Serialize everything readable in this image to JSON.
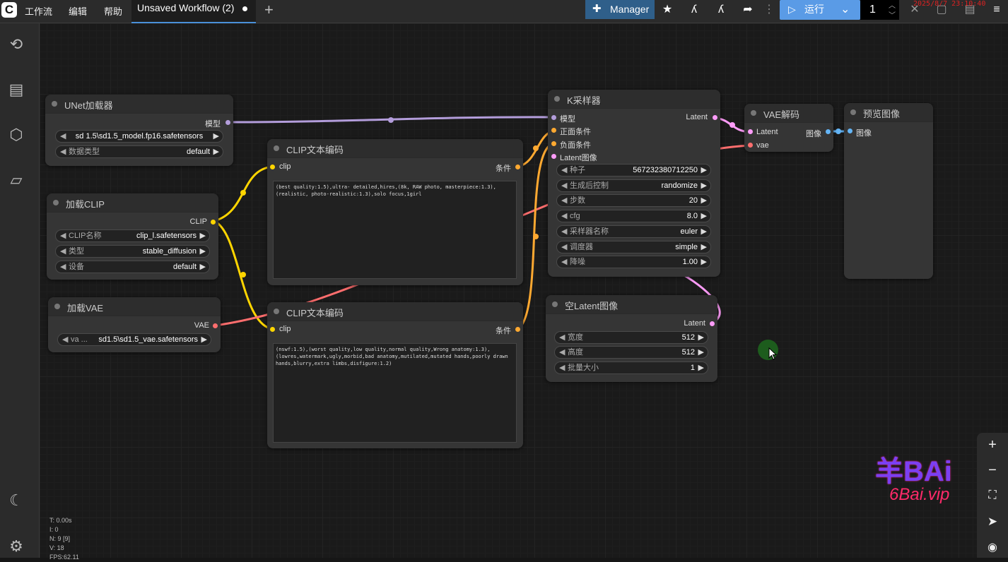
{
  "topbar": {
    "menu": [
      "工作流",
      "编辑",
      "帮助"
    ],
    "tab_title": "Unsaved Workflow (2)",
    "manager_label": "Manager",
    "run_label": "运行",
    "queue_count": "1",
    "clock_text": "2025/8/7 23:10:40"
  },
  "nodes": {
    "unet": {
      "title": "UNet加载器",
      "out": "模型",
      "w1_value": "sd 1.5\\sd1.5_model.fp16.safetensors",
      "w2_label": "数据类型",
      "w2_value": "default"
    },
    "clip_loader": {
      "title": "加载CLIP",
      "out": "CLIP",
      "w1_label": "CLIP名称",
      "w1_value": "clip_l.safetensors",
      "w2_label": "类型",
      "w2_value": "stable_diffusion",
      "w3_label": "设备",
      "w3_value": "default"
    },
    "vae_loader": {
      "title": "加载VAE",
      "out": "VAE",
      "w1_label": "va ...",
      "w1_value": "sd1.5\\sd1.5_vae.safetensors"
    },
    "clip_pos": {
      "title": "CLIP文本编码",
      "in": "clip",
      "out": "条件",
      "text": "(best quality:1.5),ultra- detailed,hires,(8k, RAW photo, masterpiece:1.3),(realistic, photo-realistic:1.3),solo focus,1girl"
    },
    "clip_neg": {
      "title": "CLIP文本编码",
      "in": "clip",
      "out": "条件",
      "text": "(nswf:1.5),(worst quality,low quality,normal quality,Wrong anatomy:1.3),(lowres,watermark,ugly,morbid,bad anatomy,mutilated,mutated hands,poorly drawn hands,blurry,extra limbs,disfigure:1.2)"
    },
    "ksampler": {
      "title": "K采样器",
      "in1": "模型",
      "in2": "正面条件",
      "in3": "负面条件",
      "in4": "Latent图像",
      "out": "Latent",
      "widgets": [
        {
          "label": "种子",
          "value": "567232380712250"
        },
        {
          "label": "生成后控制",
          "value": "randomize"
        },
        {
          "label": "步数",
          "value": "20"
        },
        {
          "label": "cfg",
          "value": "8.0"
        },
        {
          "label": "采样器名称",
          "value": "euler"
        },
        {
          "label": "调度器",
          "value": "simple"
        },
        {
          "label": "降噪",
          "value": "1.00"
        }
      ]
    },
    "vae_decode": {
      "title": "VAE解码",
      "in1": "Latent",
      "in2": "vae",
      "out": "图像"
    },
    "preview": {
      "title": "预览图像",
      "in": "图像"
    },
    "empty_latent": {
      "title": "空Latent图像",
      "out": "Latent",
      "widgets": [
        {
          "label": "宽度",
          "value": "512"
        },
        {
          "label": "高度",
          "value": "512"
        },
        {
          "label": "批量大小",
          "value": "1"
        }
      ]
    }
  },
  "stats": [
    "T: 0.00s",
    "I: 0",
    "N: 9 [9]",
    "V: 18",
    "FPS:62.11"
  ],
  "watermark": {
    "brand": "羊BAi",
    "site": "6Bai.vip"
  },
  "colors": {
    "model": "#b39ddb",
    "clip": "#ffd500",
    "vae": "#ff6e6e",
    "cond": "#ffa931",
    "latent": "#ff9cf9",
    "image": "#64b5f6",
    "accent": "#4a90d9"
  }
}
